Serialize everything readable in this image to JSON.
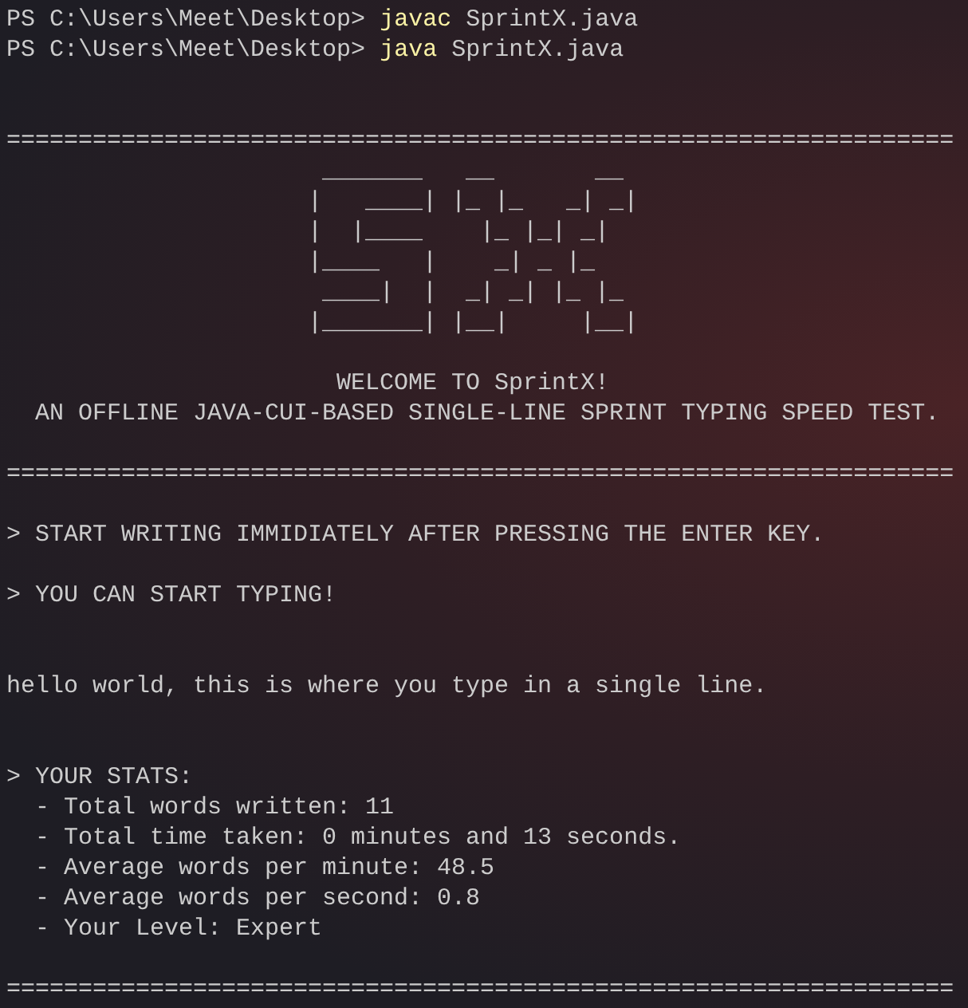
{
  "terminal": {
    "lines": [
      {
        "kind": "command",
        "prompt": "PS C:\\Users\\Meet\\Desktop>",
        "command": "javac",
        "args": "SprintX.java"
      },
      {
        "kind": "command",
        "prompt": "PS C:\\Users\\Meet\\Desktop>",
        "command": "java",
        "args": "SprintX.java"
      },
      {
        "kind": "blank"
      },
      {
        "kind": "blank"
      },
      {
        "kind": "rule",
        "text": "=================================================================="
      },
      {
        "kind": "art",
        "text": "                      _______   __       __"
      },
      {
        "kind": "art",
        "text": "                     |   ____| |_ |_   _| _|"
      },
      {
        "kind": "art",
        "text": "                     |  |____    |_ |_| _|"
      },
      {
        "kind": "art",
        "text": "                     |____   |    _| _ |_"
      },
      {
        "kind": "art",
        "text": "                      ____|  |  _| _| |_ |_"
      },
      {
        "kind": "art",
        "text": "                     |_______| |__|     |__|"
      },
      {
        "kind": "blank"
      },
      {
        "kind": "text",
        "text": "                       WELCOME TO SprintX!"
      },
      {
        "kind": "text",
        "text": "  AN OFFLINE JAVA-CUI-BASED SINGLE-LINE SPRINT TYPING SPEED TEST."
      },
      {
        "kind": "blank"
      },
      {
        "kind": "rule",
        "text": "=================================================================="
      },
      {
        "kind": "blank"
      },
      {
        "kind": "text",
        "text": "> START WRITING IMMIDIATELY AFTER PRESSING THE ENTER KEY."
      },
      {
        "kind": "blank"
      },
      {
        "kind": "text",
        "text": "> YOU CAN START TYPING!"
      },
      {
        "kind": "blank"
      },
      {
        "kind": "blank"
      },
      {
        "kind": "input",
        "text": "hello world, this is where you type in a single line."
      },
      {
        "kind": "blank"
      },
      {
        "kind": "blank"
      },
      {
        "kind": "text",
        "text": "> YOUR STATS:"
      },
      {
        "kind": "text",
        "text": "  - Total words written: 11"
      },
      {
        "kind": "text",
        "text": "  - Total time taken: 0 minutes and 13 seconds."
      },
      {
        "kind": "text",
        "text": "  - Average words per minute: 48.5"
      },
      {
        "kind": "text",
        "text": "  - Average words per second: 0.8"
      },
      {
        "kind": "text",
        "text": "  - Your Level: Expert"
      },
      {
        "kind": "blank"
      },
      {
        "kind": "rule",
        "text": "=================================================================="
      }
    ]
  }
}
